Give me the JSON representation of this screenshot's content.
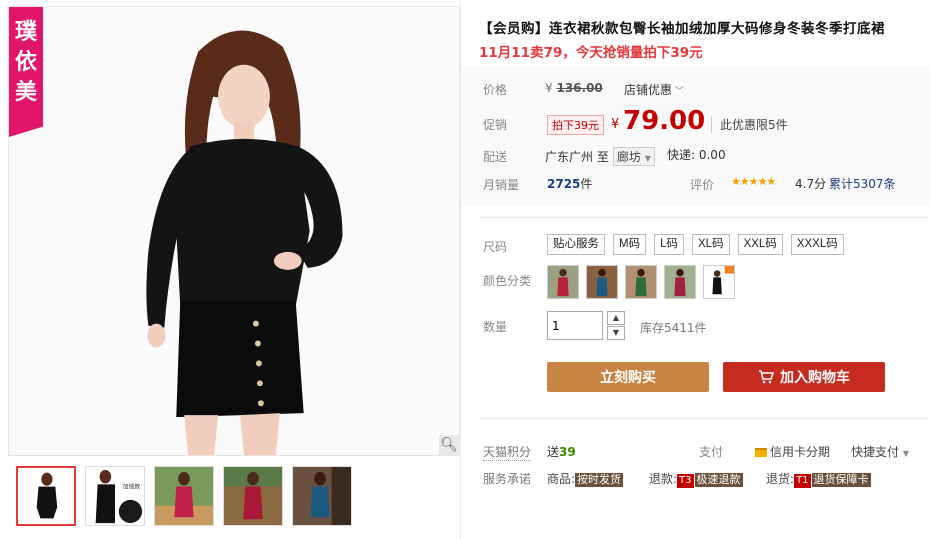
{
  "brand": {
    "badge_chars": [
      "璞",
      "依",
      "美"
    ]
  },
  "gallery": {
    "zoom_icon": "magnifier-icon",
    "thumbnails": [
      {
        "name": "black-dress",
        "color": "#111111",
        "bg": "#ffffff"
      },
      {
        "name": "black-dress-fleece",
        "color": "#111111",
        "bg": "#ffffff",
        "tag": "加绒款"
      },
      {
        "name": "red-dress",
        "color": "#c0204a",
        "bg": "#7a9a5a"
      },
      {
        "name": "red-dress-outdoor",
        "color": "#a81a38",
        "bg": "#8a6a40"
      },
      {
        "name": "blue-dress",
        "color": "#1d5a80",
        "bg": "#6a5040"
      }
    ]
  },
  "product": {
    "title": "【会员购】连衣裙秋款包臀长袖加绒加厚大码修身冬装冬季打底裙",
    "promo": "11月11卖79，今天抢销量拍下39元"
  },
  "price": {
    "label": "价格",
    "currency": "¥",
    "original": "136.00",
    "shop_discount": "店铺优惠",
    "promo_label": "促销",
    "promo_tag": "拍下39元",
    "current": "79.00",
    "limit": "此优惠限5件"
  },
  "shipping": {
    "label": "配送",
    "from": "广东广州",
    "to_word": "至",
    "dest": "廊坊",
    "express": "快递: 0.00"
  },
  "sales": {
    "label": "月销量",
    "count": "2725",
    "unit": "件",
    "rating_label": "评价",
    "stars": "★★★★★",
    "score": "4.7分",
    "reviews": "累计5307条"
  },
  "options": {
    "size_label": "尺码",
    "sizes": [
      "贴心服务",
      "M码",
      "L码",
      "XL码",
      "XXL码",
      "XXXL码"
    ],
    "color_label": "颜色分类",
    "colors": [
      {
        "name": "red",
        "hex": "#b8203a"
      },
      {
        "name": "blue",
        "hex": "#1d5a80"
      },
      {
        "name": "green",
        "hex": "#2f6b3a"
      },
      {
        "name": "red-2",
        "hex": "#a02040"
      },
      {
        "name": "black",
        "hex": "#111111"
      }
    ]
  },
  "quantity": {
    "label": "数量",
    "value": "1",
    "stock": "库存5411件"
  },
  "actions": {
    "buy_now": "立刻购买",
    "add_to_cart": "加入购物车"
  },
  "extras": {
    "points_label": "天猫积分",
    "points_prefix": "送",
    "points": "39",
    "pay_label": "支付",
    "credit": "信用卡分期",
    "fastpay": "快捷支付",
    "service_label": "服务承诺",
    "goods_prefix": "商品:",
    "goods_chip": "按时发货",
    "refund_prefix": "退款:",
    "refund_tag": "T3",
    "refund_chip": "极速退款",
    "return_prefix": "退货:",
    "return_tag": "T1",
    "return_chip": "退货保障卡"
  }
}
